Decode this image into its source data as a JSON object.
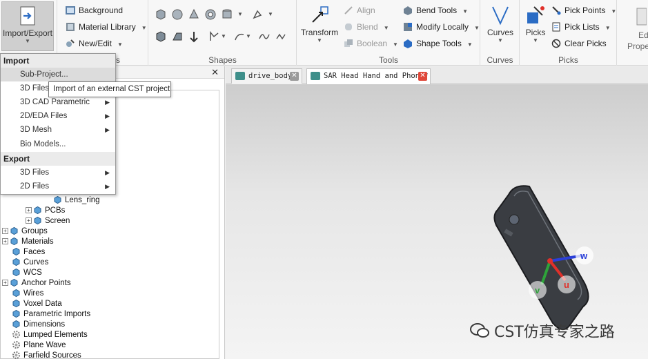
{
  "ribbon": {
    "import_export": {
      "label": "Import/Export"
    },
    "materials_group": {
      "background": "Background",
      "material_library": "Material Library",
      "new_edit": "New/Edit",
      "group_label": "ls"
    },
    "shapes_group": {
      "label": "Shapes"
    },
    "tools_group": {
      "transform": "Transform",
      "align": "Align",
      "blend": "Blend",
      "boolean": "Boolean",
      "bend_tools": "Bend Tools",
      "modify_locally": "Modify Locally",
      "shape_tools": "Shape Tools",
      "group_label": "Tools"
    },
    "curves_group": {
      "curves": "Curves",
      "group_label": "Curves"
    },
    "picks_group": {
      "picks": "Picks",
      "pick_points": "Pick Points",
      "pick_lists": "Pick Lists",
      "clear_picks": "Clear Picks",
      "group_label": "Picks"
    },
    "edit_group": {
      "label_1": "Edi",
      "label_2": "Prope"
    }
  },
  "menu": {
    "import_header": "Import",
    "export_header": "Export",
    "import_items": [
      {
        "label": "Sub-Project...",
        "has_submenu": false
      },
      {
        "label": "3D Files",
        "has_submenu": true
      },
      {
        "label": "3D CAD Parametric",
        "has_submenu": true
      },
      {
        "label": "2D/EDA Files",
        "has_submenu": true
      },
      {
        "label": "3D Mesh",
        "has_submenu": true
      },
      {
        "label": "Bio Models...",
        "has_submenu": false
      }
    ],
    "export_items": [
      {
        "label": "3D Files",
        "has_submenu": true
      },
      {
        "label": "2D Files",
        "has_submenu": true
      }
    ],
    "tooltip": "Import of an external CST project"
  },
  "panel": {
    "close": "✕"
  },
  "tree": {
    "items": [
      {
        "label": "Lens_ring"
      },
      {
        "label": "PCBs"
      },
      {
        "label": "Screen"
      },
      {
        "label": "Groups"
      },
      {
        "label": "Materials"
      },
      {
        "label": "Faces"
      },
      {
        "label": "Curves"
      },
      {
        "label": "WCS"
      },
      {
        "label": "Anchor Points"
      },
      {
        "label": "Wires"
      },
      {
        "label": "Voxel Data"
      },
      {
        "label": "Parametric Imports"
      },
      {
        "label": "Dimensions"
      },
      {
        "label": "Lumped Elements"
      },
      {
        "label": "Plane Wave"
      },
      {
        "label": "Farfield Sources"
      }
    ]
  },
  "tabs": [
    {
      "label": "drive_body",
      "close": "✕"
    },
    {
      "label": "SAR Head Hand and Phone*",
      "close": "✕"
    }
  ],
  "viewport": {
    "axis_u": "u",
    "axis_v": "v",
    "axis_w": "w",
    "watermark": "CST仿真专家之路"
  },
  "colors": {
    "accent_blue": "#2b6cc4",
    "tab_close_active": "#e0483a",
    "axis_u": "#e0302a",
    "axis_v": "#2ea33a",
    "axis_w": "#2a3fd8"
  }
}
